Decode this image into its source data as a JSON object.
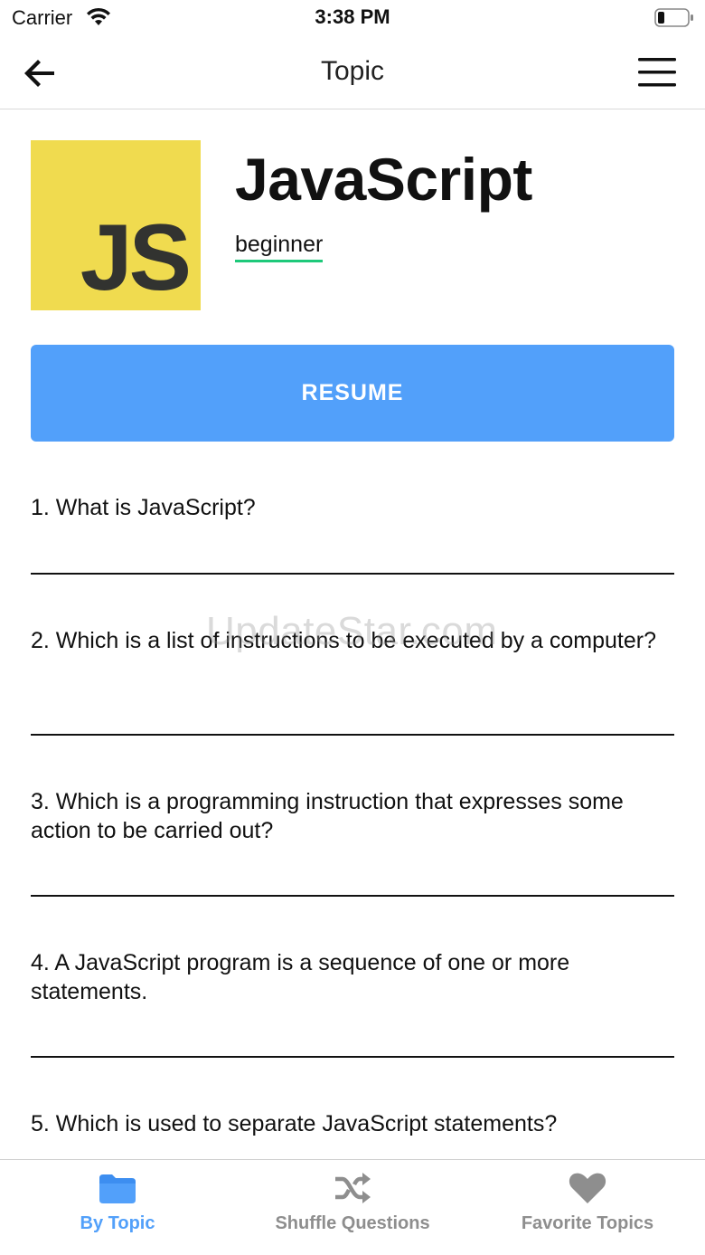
{
  "status": {
    "carrier": "Carrier",
    "time": "3:38 PM"
  },
  "nav": {
    "title": "Topic"
  },
  "topic": {
    "logo_text": "JS",
    "name": "JavaScript",
    "level": "beginner"
  },
  "resume": {
    "label": "RESUME"
  },
  "questions": [
    "1. What is JavaScript?",
    "2. Which is a list of instructions to be executed by a computer?",
    "3. Which is a programming instruction that expresses some action to be carried out?",
    "4. A JavaScript program is a sequence of one or more statements.",
    "5. Which is used to separate JavaScript statements?"
  ],
  "watermark": "UpdateStar.com",
  "tabs": [
    {
      "label": "By Topic",
      "icon": "folder-icon",
      "active": true
    },
    {
      "label": "Shuffle Questions",
      "icon": "shuffle-icon",
      "active": false
    },
    {
      "label": "Favorite Topics",
      "icon": "heart-icon",
      "active": false
    }
  ],
  "colors": {
    "accent": "#52a0fa",
    "level_underline": "#1ec97a",
    "logo_bg": "#f0db4f",
    "inactive": "#8e8e8e"
  }
}
